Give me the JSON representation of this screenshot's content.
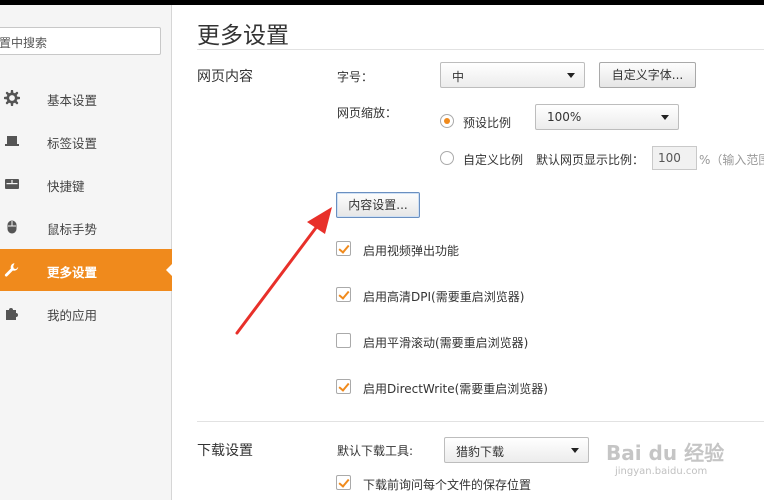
{
  "sidebar": {
    "search_placeholder": "置中搜索",
    "items": [
      {
        "label": "基本设置",
        "icon": "gear-icon"
      },
      {
        "label": "标签设置",
        "icon": "laptop-icon"
      },
      {
        "label": "快捷键",
        "icon": "keyboard-icon"
      },
      {
        "label": "鼠标手势",
        "icon": "mouse-icon"
      },
      {
        "label": "更多设置",
        "icon": "wrench-icon",
        "active": true
      },
      {
        "label": "我的应用",
        "icon": "puzzle-icon"
      }
    ]
  },
  "main": {
    "title": "更多设置",
    "web_content": {
      "section_title": "网页内容",
      "font_size_label": "字号：",
      "font_size_value": "中",
      "custom_font_button": "自定义字体...",
      "zoom_label": "网页缩放：",
      "preset_ratio_label": "预设比例",
      "preset_ratio_value": "100%",
      "custom_ratio_label": "自定义比例",
      "default_ratio_label": "默认网页显示比例：",
      "default_ratio_value": "100",
      "percent_hint": "%（输入范围",
      "content_settings_button": "内容设置...",
      "options": [
        {
          "label": "启用视频弹出功能",
          "checked": true
        },
        {
          "label": "启用高清DPI(需要重启浏览器)",
          "checked": true
        },
        {
          "label": "启用平滑滚动(需要重启浏览器)",
          "checked": false
        },
        {
          "label": "启用DirectWrite(需要重启浏览器)",
          "checked": true
        }
      ]
    },
    "download": {
      "section_title": "下载设置",
      "tool_label": "默认下载工具:",
      "tool_value": "猎豹下载",
      "ask_location_label": "下载前询问每个文件的保存位置",
      "ask_location_checked": true
    }
  },
  "watermark": {
    "brand": "Bai du 经验",
    "url": "jingyan.baidu.com"
  },
  "colors": {
    "accent": "#f08a1c",
    "arrow": "#e8302a"
  }
}
